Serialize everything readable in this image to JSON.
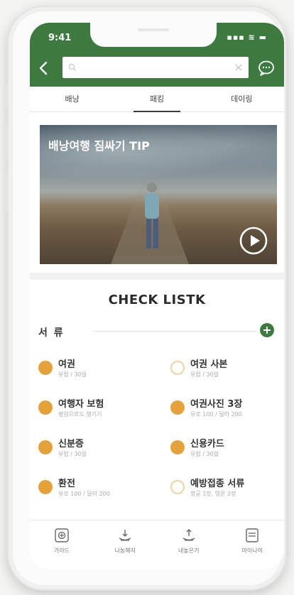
{
  "status_bar": {
    "time": "9:41",
    "indicators": "▪▪▪ ≋ ▬"
  },
  "search": {
    "value": "",
    "placeholder": ""
  },
  "tabs": [
    {
      "label": "배낭",
      "active": false
    },
    {
      "label": "패킹",
      "active": true
    },
    {
      "label": "데이링",
      "active": false
    }
  ],
  "video": {
    "title": "배낭여행 짐싸기 TIP",
    "icon": "play-icon"
  },
  "checklist": {
    "title": "CHECK LISTK",
    "category": "서 류",
    "items": [
      {
        "label": "여권",
        "sub": "유럽 / 30일",
        "checked": true
      },
      {
        "label": "여권 사본",
        "sub": "유럽 / 30일",
        "checked": false
      },
      {
        "label": "여행자 보험",
        "sub": "병원으로도 챙기기",
        "checked": true
      },
      {
        "label": "여권사진 3장",
        "sub": "유로 100 / 달러 200",
        "checked": true
      },
      {
        "label": "신분증",
        "sub": "유럽 / 30일",
        "checked": true
      },
      {
        "label": "신용카드",
        "sub": "유럽 / 30일",
        "checked": true
      },
      {
        "label": "환전",
        "sub": "유로 100 / 달러 200",
        "checked": true
      },
      {
        "label": "예방접종 서류",
        "sub": "항공 1장, 영문 2장",
        "checked": false
      }
    ]
  },
  "bottom_nav": [
    {
      "label": "가이드",
      "icon": "guide-icon"
    },
    {
      "label": "나눔해지",
      "icon": "share-icon"
    },
    {
      "label": "내놓은기",
      "icon": "upload-icon"
    },
    {
      "label": "마이나이",
      "icon": "my-page-icon"
    }
  ],
  "colors": {
    "brand_green": "#3c7a3f",
    "checked_orange": "#e6a23a"
  }
}
